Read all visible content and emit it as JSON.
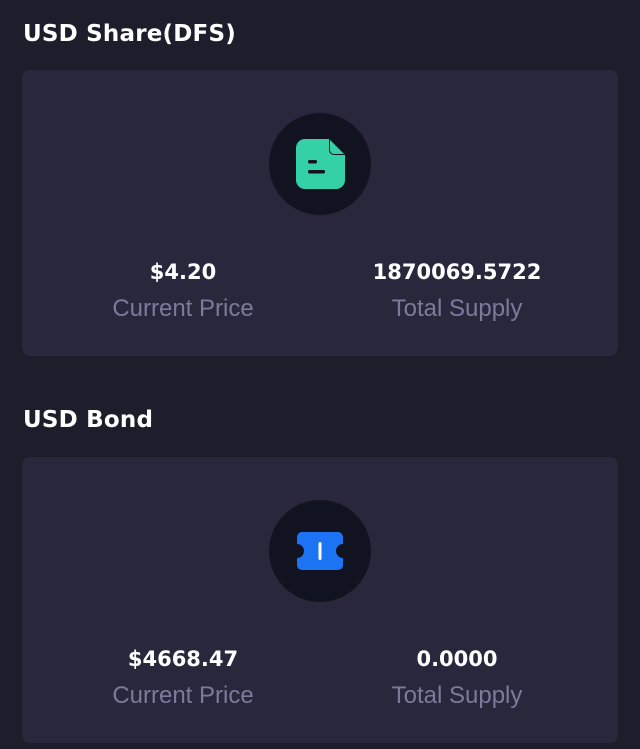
{
  "sections": [
    {
      "title": "USD Share(DFS)",
      "icon": "document-icon",
      "icon_color": "#34d1a6",
      "price_value": "$4.20",
      "price_label": "Current Price",
      "supply_value": "1870069.5722",
      "supply_label": "Total Supply"
    },
    {
      "title": "USD Bond",
      "icon": "ticket-icon",
      "icon_color": "#1c74f4",
      "price_value": "$4668.47",
      "price_label": "Current Price",
      "supply_value": "0.0000",
      "supply_label": "Total Supply"
    }
  ],
  "colors": {
    "page_background": "#1e1d2b",
    "card_background": "#28273b",
    "icon_circle": "#111420",
    "label_text": "#7c7a9b",
    "value_text": "#ffffff"
  }
}
